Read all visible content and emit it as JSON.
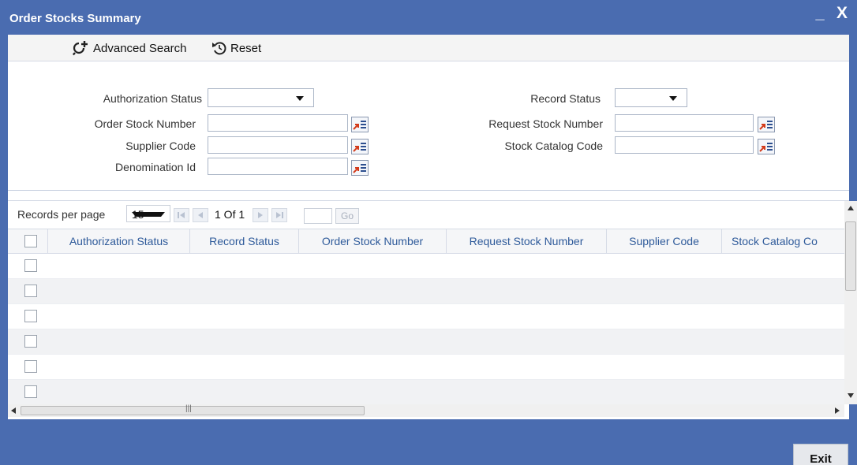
{
  "window": {
    "title": "Order Stocks Summary",
    "minimize_label": "_",
    "close_label": "X"
  },
  "toolbar": {
    "advanced_search_label": "Advanced Search",
    "advanced_search_icon": "magnifier-plus-icon",
    "reset_label": "Reset",
    "reset_icon": "reset-icon"
  },
  "search_form": {
    "authorization_status": {
      "label": "Authorization Status",
      "value": ""
    },
    "record_status": {
      "label": "Record Status",
      "value": ""
    },
    "order_stock_number": {
      "label": "Order Stock Number",
      "value": ""
    },
    "request_stock_number": {
      "label": "Request Stock Number",
      "value": ""
    },
    "supplier_code": {
      "label": "Supplier Code",
      "value": ""
    },
    "stock_catalog_code": {
      "label": "Stock Catalog Code",
      "value": ""
    },
    "denomination_id": {
      "label": "Denomination Id",
      "value": ""
    },
    "lov_icon": "list-of-values-icon"
  },
  "pager": {
    "records_per_page_label": "Records per page",
    "records_per_page_value": "15",
    "page_text": "1 Of 1",
    "goto_value": "",
    "go_label": "Go"
  },
  "grid": {
    "columns": [
      "Authorization Status",
      "Record Status",
      "Order Stock Number",
      "Request Stock Number",
      "Supplier Code",
      "Stock Catalog Co"
    ],
    "rows": [
      {},
      {},
      {},
      {},
      {},
      {}
    ]
  },
  "footer": {
    "exit_label": "Exit"
  },
  "colors": {
    "window_chrome": "#4a6cb0",
    "column_header_text": "#2e5a9a",
    "row_alt": "#f1f2f4"
  }
}
